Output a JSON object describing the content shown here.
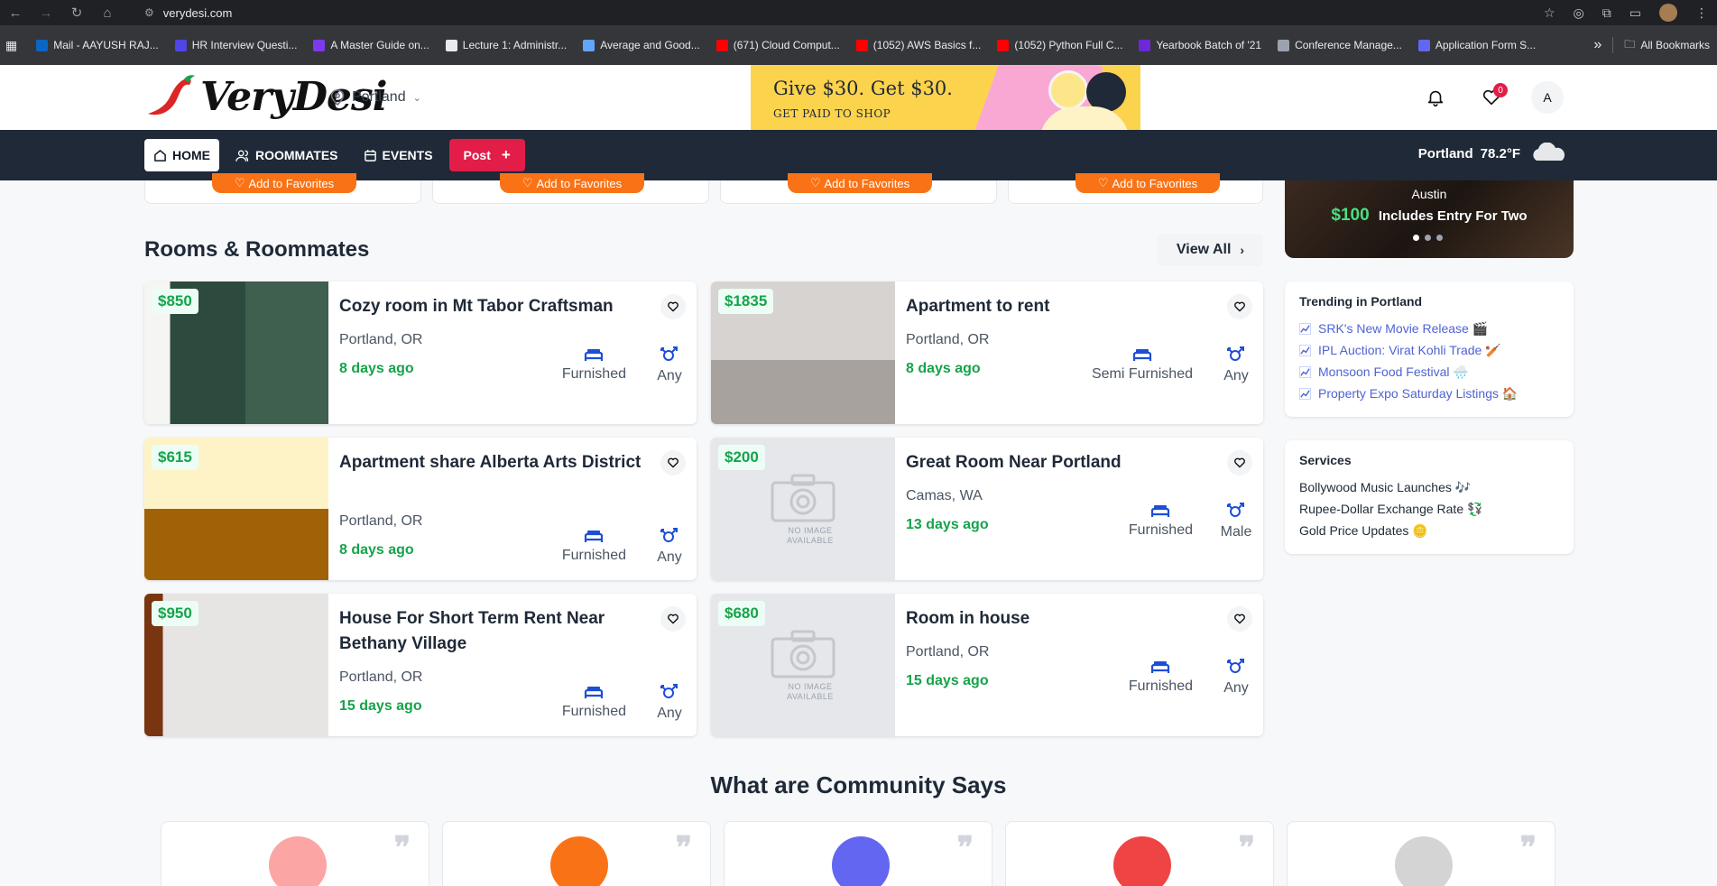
{
  "browser": {
    "url": "verydesi.com",
    "bookmarks": [
      {
        "label": "Mail - AAYUSH RAJ...",
        "color": "#0a66c2"
      },
      {
        "label": "HR Interview Questi...",
        "color": "#4f46e5"
      },
      {
        "label": "A Master Guide on...",
        "color": "#7c3aed"
      },
      {
        "label": "Lecture 1: Administr...",
        "color": "#e8eaed"
      },
      {
        "label": "Average and Good...",
        "color": "#60a5fa"
      },
      {
        "label": "(671) Cloud Comput...",
        "color": "#ff0000"
      },
      {
        "label": "(1052) AWS Basics f...",
        "color": "#ff0000"
      },
      {
        "label": "(1052) Python Full C...",
        "color": "#ff0000"
      },
      {
        "label": "Yearbook Batch of '21",
        "color": "#6d28d9"
      },
      {
        "label": "Conference Manage...",
        "color": "#9ca3af"
      },
      {
        "label": "Application Form S...",
        "color": "#6366f1"
      }
    ],
    "more_label": "»",
    "all_bookmarks": "All Bookmarks"
  },
  "header": {
    "logo_text": "VeryDesi",
    "location": "Portland",
    "ad_title": "Give $30. Get $30.",
    "ad_subtitle": "GET PAID TO SHOP",
    "cart_count": "0",
    "avatar_letter": "A"
  },
  "nav": {
    "items": [
      {
        "label": "HOME",
        "icon": "home-icon"
      },
      {
        "label": "ROOMMATES",
        "icon": "users-icon"
      },
      {
        "label": "EVENTS",
        "icon": "calendar-icon"
      }
    ],
    "post_label": "Post",
    "weather_city": "Portland",
    "weather_temp": "78.2°F"
  },
  "favorites": {
    "label": "Add to Favorites"
  },
  "rooms": {
    "title": "Rooms & Roommates",
    "view_all": "View All",
    "items": [
      {
        "price": "$850",
        "title": "Cozy room in Mt Tabor Craftsman",
        "location": "Portland, OR",
        "date": "8 days ago",
        "furnishing": "Furnished",
        "gender": "Any",
        "image": "bedroom-photo"
      },
      {
        "price": "$1835",
        "title": "Apartment to rent",
        "location": "Portland, OR",
        "date": "8 days ago",
        "furnishing": "Semi Furnished",
        "gender": "Any",
        "image": "living-room-photo"
      },
      {
        "price": "$615",
        "title": "Apartment share Alberta Arts District",
        "location": "Portland, OR",
        "date": "8 days ago",
        "furnishing": "Furnished",
        "gender": "Any",
        "image": "lounge-photo"
      },
      {
        "price": "$200",
        "title": "Great Room Near Portland",
        "location": "Camas, WA",
        "date": "13 days ago",
        "furnishing": "Furnished",
        "gender": "Male",
        "image": "no-image"
      },
      {
        "price": "$950",
        "title": "House For Short Term Rent Near Bethany Village",
        "location": "Portland, OR",
        "date": "15 days ago",
        "furnishing": "Furnished",
        "gender": "Any",
        "image": "small-room-photo"
      },
      {
        "price": "$680",
        "title": "Room in house",
        "location": "Portland, OR",
        "date": "15 days ago",
        "furnishing": "Furnished",
        "gender": "Any",
        "image": "no-image"
      }
    ],
    "no_image_line1": "NO IMAGE",
    "no_image_line2": "AVAILABLE"
  },
  "sidebar": {
    "promo_city": "Austin",
    "promo_price": "$100",
    "promo_text": "Includes Entry For Two",
    "trending_title": "Trending in Portland",
    "trending": [
      "SRK's New Movie Release 🎬",
      "IPL Auction: Virat Kohli Trade 🏏",
      "Monsoon Food Festival 🌧️",
      "Property Expo Saturday Listings 🏠"
    ],
    "services_title": "Services",
    "services": [
      "Bollywood Music Launches 🎶",
      "Rupee-Dollar Exchange Rate 💱",
      "Gold Price Updates 🪙"
    ]
  },
  "community": {
    "title": "What are Community Says",
    "avatar_colors": [
      "#fca5a5",
      "#f97316",
      "#6366f1",
      "#ef4444",
      "#d4d4d4"
    ]
  },
  "colors": {
    "accent": "#e11d48",
    "price_green": "#16a34a",
    "nav_bg": "#1f2937"
  }
}
